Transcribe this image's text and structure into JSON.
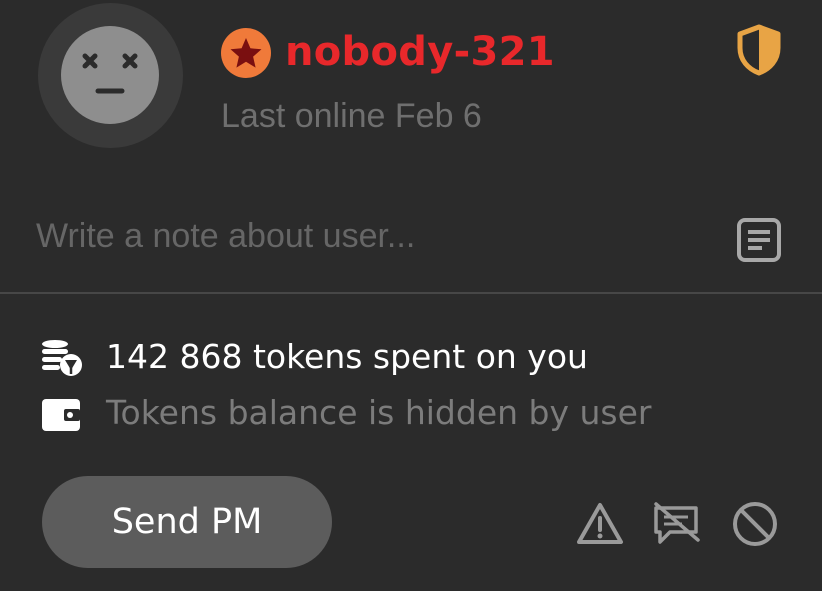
{
  "profile": {
    "username": "nobody-321",
    "last_online": "Last online Feb 6",
    "avatar_icon": "dizzy-face-avatar",
    "badge_icon": "star-badge-icon",
    "shield_icon": "half-shield-icon"
  },
  "note": {
    "placeholder": "Write a note about user...",
    "value": "",
    "icon": "note-icon"
  },
  "stats": {
    "tokens_spent": "142 868 tokens spent on you",
    "tokens_spent_icon": "coins-icon",
    "balance": "Tokens balance is hidden by user",
    "balance_icon": "wallet-icon"
  },
  "actions": {
    "send_pm_label": "Send PM",
    "report_icon": "warning-icon",
    "hide_messages_icon": "chat-off-icon",
    "block_icon": "ban-icon"
  },
  "colors": {
    "background": "#2b2b2b",
    "username": "#e8282b",
    "badge": "#f07a3a",
    "shield": "#e8a445",
    "muted_text": "#6f6f6f",
    "button": "#5c5c5c"
  }
}
